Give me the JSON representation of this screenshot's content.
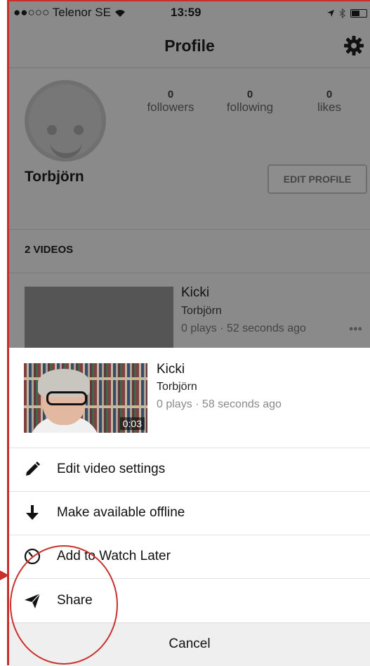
{
  "status_bar": {
    "carrier": "●●○○○ Telenor SE",
    "time": "13:59"
  },
  "nav": {
    "title": "Profile",
    "settings_icon": "gear-icon"
  },
  "profile": {
    "stats": [
      {
        "value": "0",
        "label": "followers"
      },
      {
        "value": "0",
        "label": "following"
      },
      {
        "value": "0",
        "label": "likes"
      }
    ],
    "username": "Torbjörn",
    "edit_button": "EDIT PROFILE",
    "videos_header": "2 VIDEOS",
    "background_video": {
      "title": "Kicki",
      "author": "Torbjörn",
      "meta": "0 plays · 52 seconds ago",
      "more": "•••"
    }
  },
  "sheet": {
    "video": {
      "title": "Kicki",
      "author": "Torbjörn",
      "meta": "0 plays · 58 seconds ago",
      "duration": "0:03"
    },
    "actions": [
      {
        "label": "Edit video settings",
        "icon": "pencil-icon"
      },
      {
        "label": "Make available offline",
        "icon": "download-arrow-icon"
      },
      {
        "label": "Add to Watch Later",
        "icon": "clock-icon"
      },
      {
        "label": "Share",
        "icon": "paper-plane-icon"
      }
    ],
    "cancel": "Cancel"
  },
  "colors": {
    "annotation": "#c9302c",
    "dim_overlay": "#8a8a8a"
  }
}
